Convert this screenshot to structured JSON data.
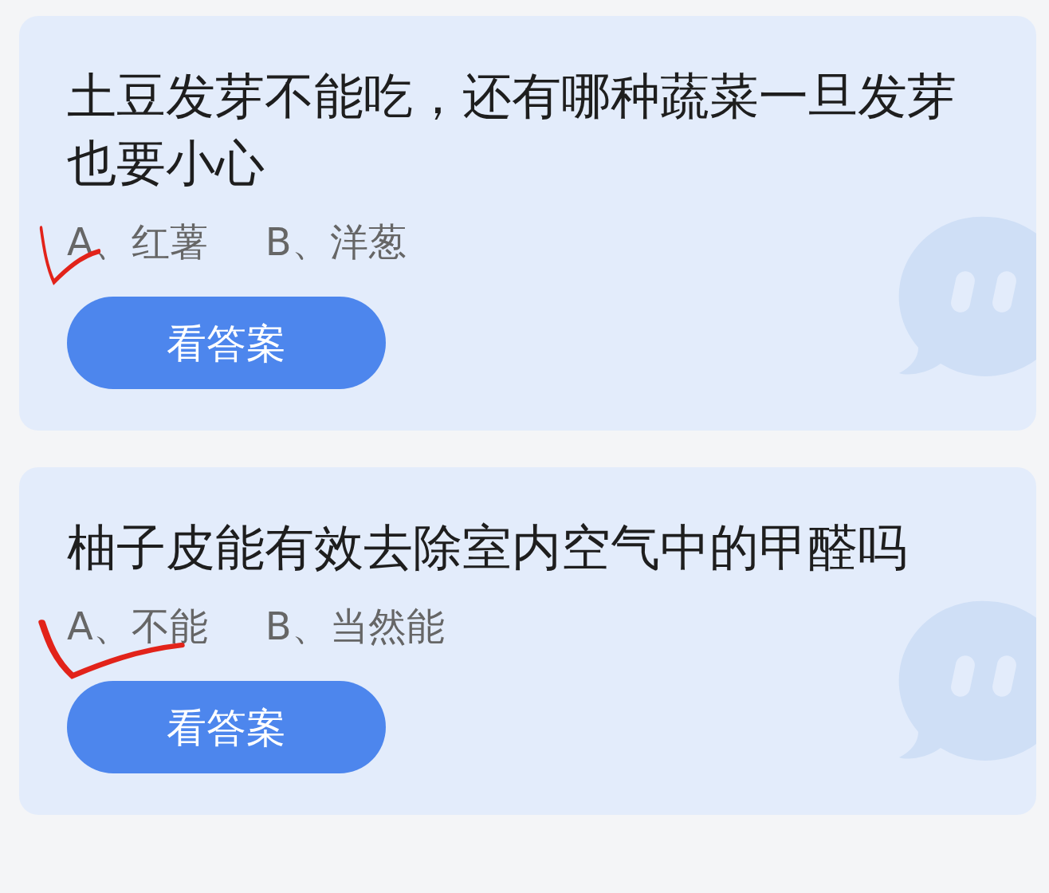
{
  "questions": [
    {
      "title": "土豆发芽不能吃，还有哪种蔬菜一旦发芽也要小心",
      "options": [
        {
          "label": "A、红薯",
          "marked": true
        },
        {
          "label": "B、洋葱",
          "marked": false
        }
      ],
      "button": "看答案"
    },
    {
      "title": "柚子皮能有效去除室内空气中的甲醛吗",
      "options": [
        {
          "label": "A、不能",
          "marked": true
        },
        {
          "label": "B、当然能",
          "marked": false
        }
      ],
      "button": "看答案"
    }
  ]
}
